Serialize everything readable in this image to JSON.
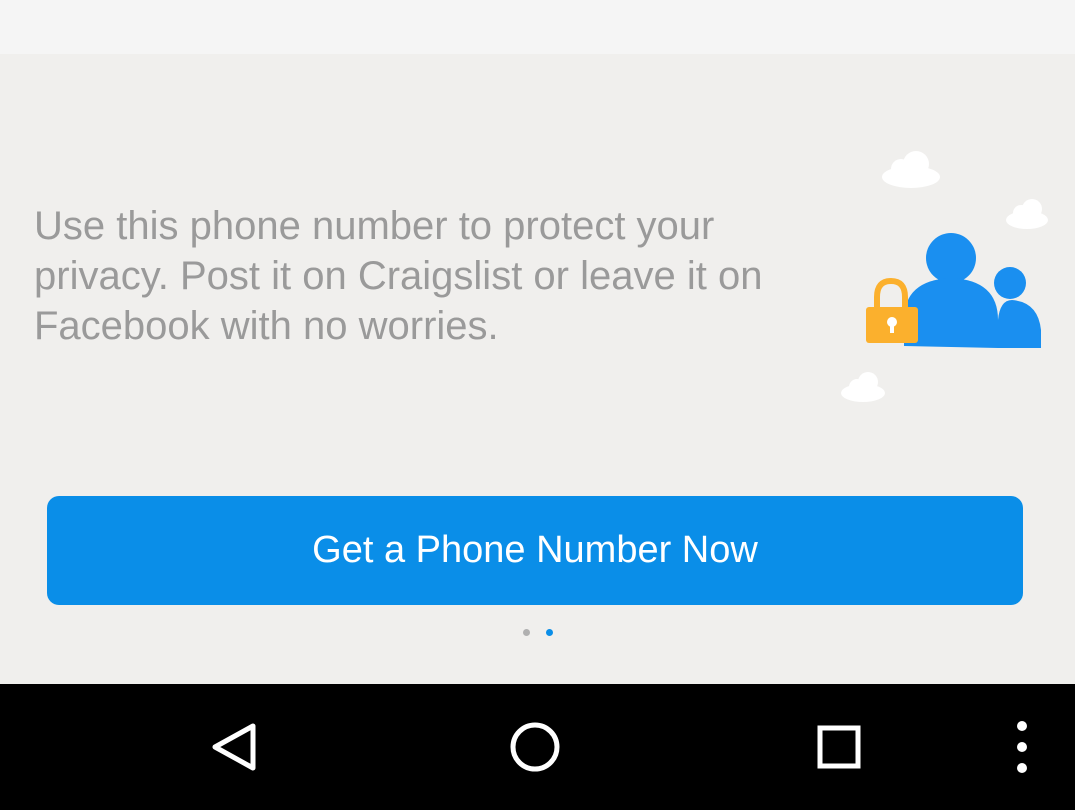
{
  "onboarding": {
    "description": "Use this phone number to protect your privacy. Post it on Craigslist or leave it on Facebook with no worries.",
    "cta_label": "Get a Phone Number Now",
    "illustration_icons": [
      "cloud-icon",
      "padlock-icon",
      "people-icon"
    ],
    "pager": {
      "total_pages": 2,
      "active_page": 2
    }
  },
  "navbar": {
    "buttons": [
      "back-icon",
      "home-icon",
      "recents-icon",
      "overflow-menu-icon"
    ]
  },
  "colors": {
    "accent": "#0a8ee8",
    "lock": "#fbb02d",
    "background": "#f0efed",
    "text": "#9a9a9a",
    "navbar": "#000000"
  }
}
